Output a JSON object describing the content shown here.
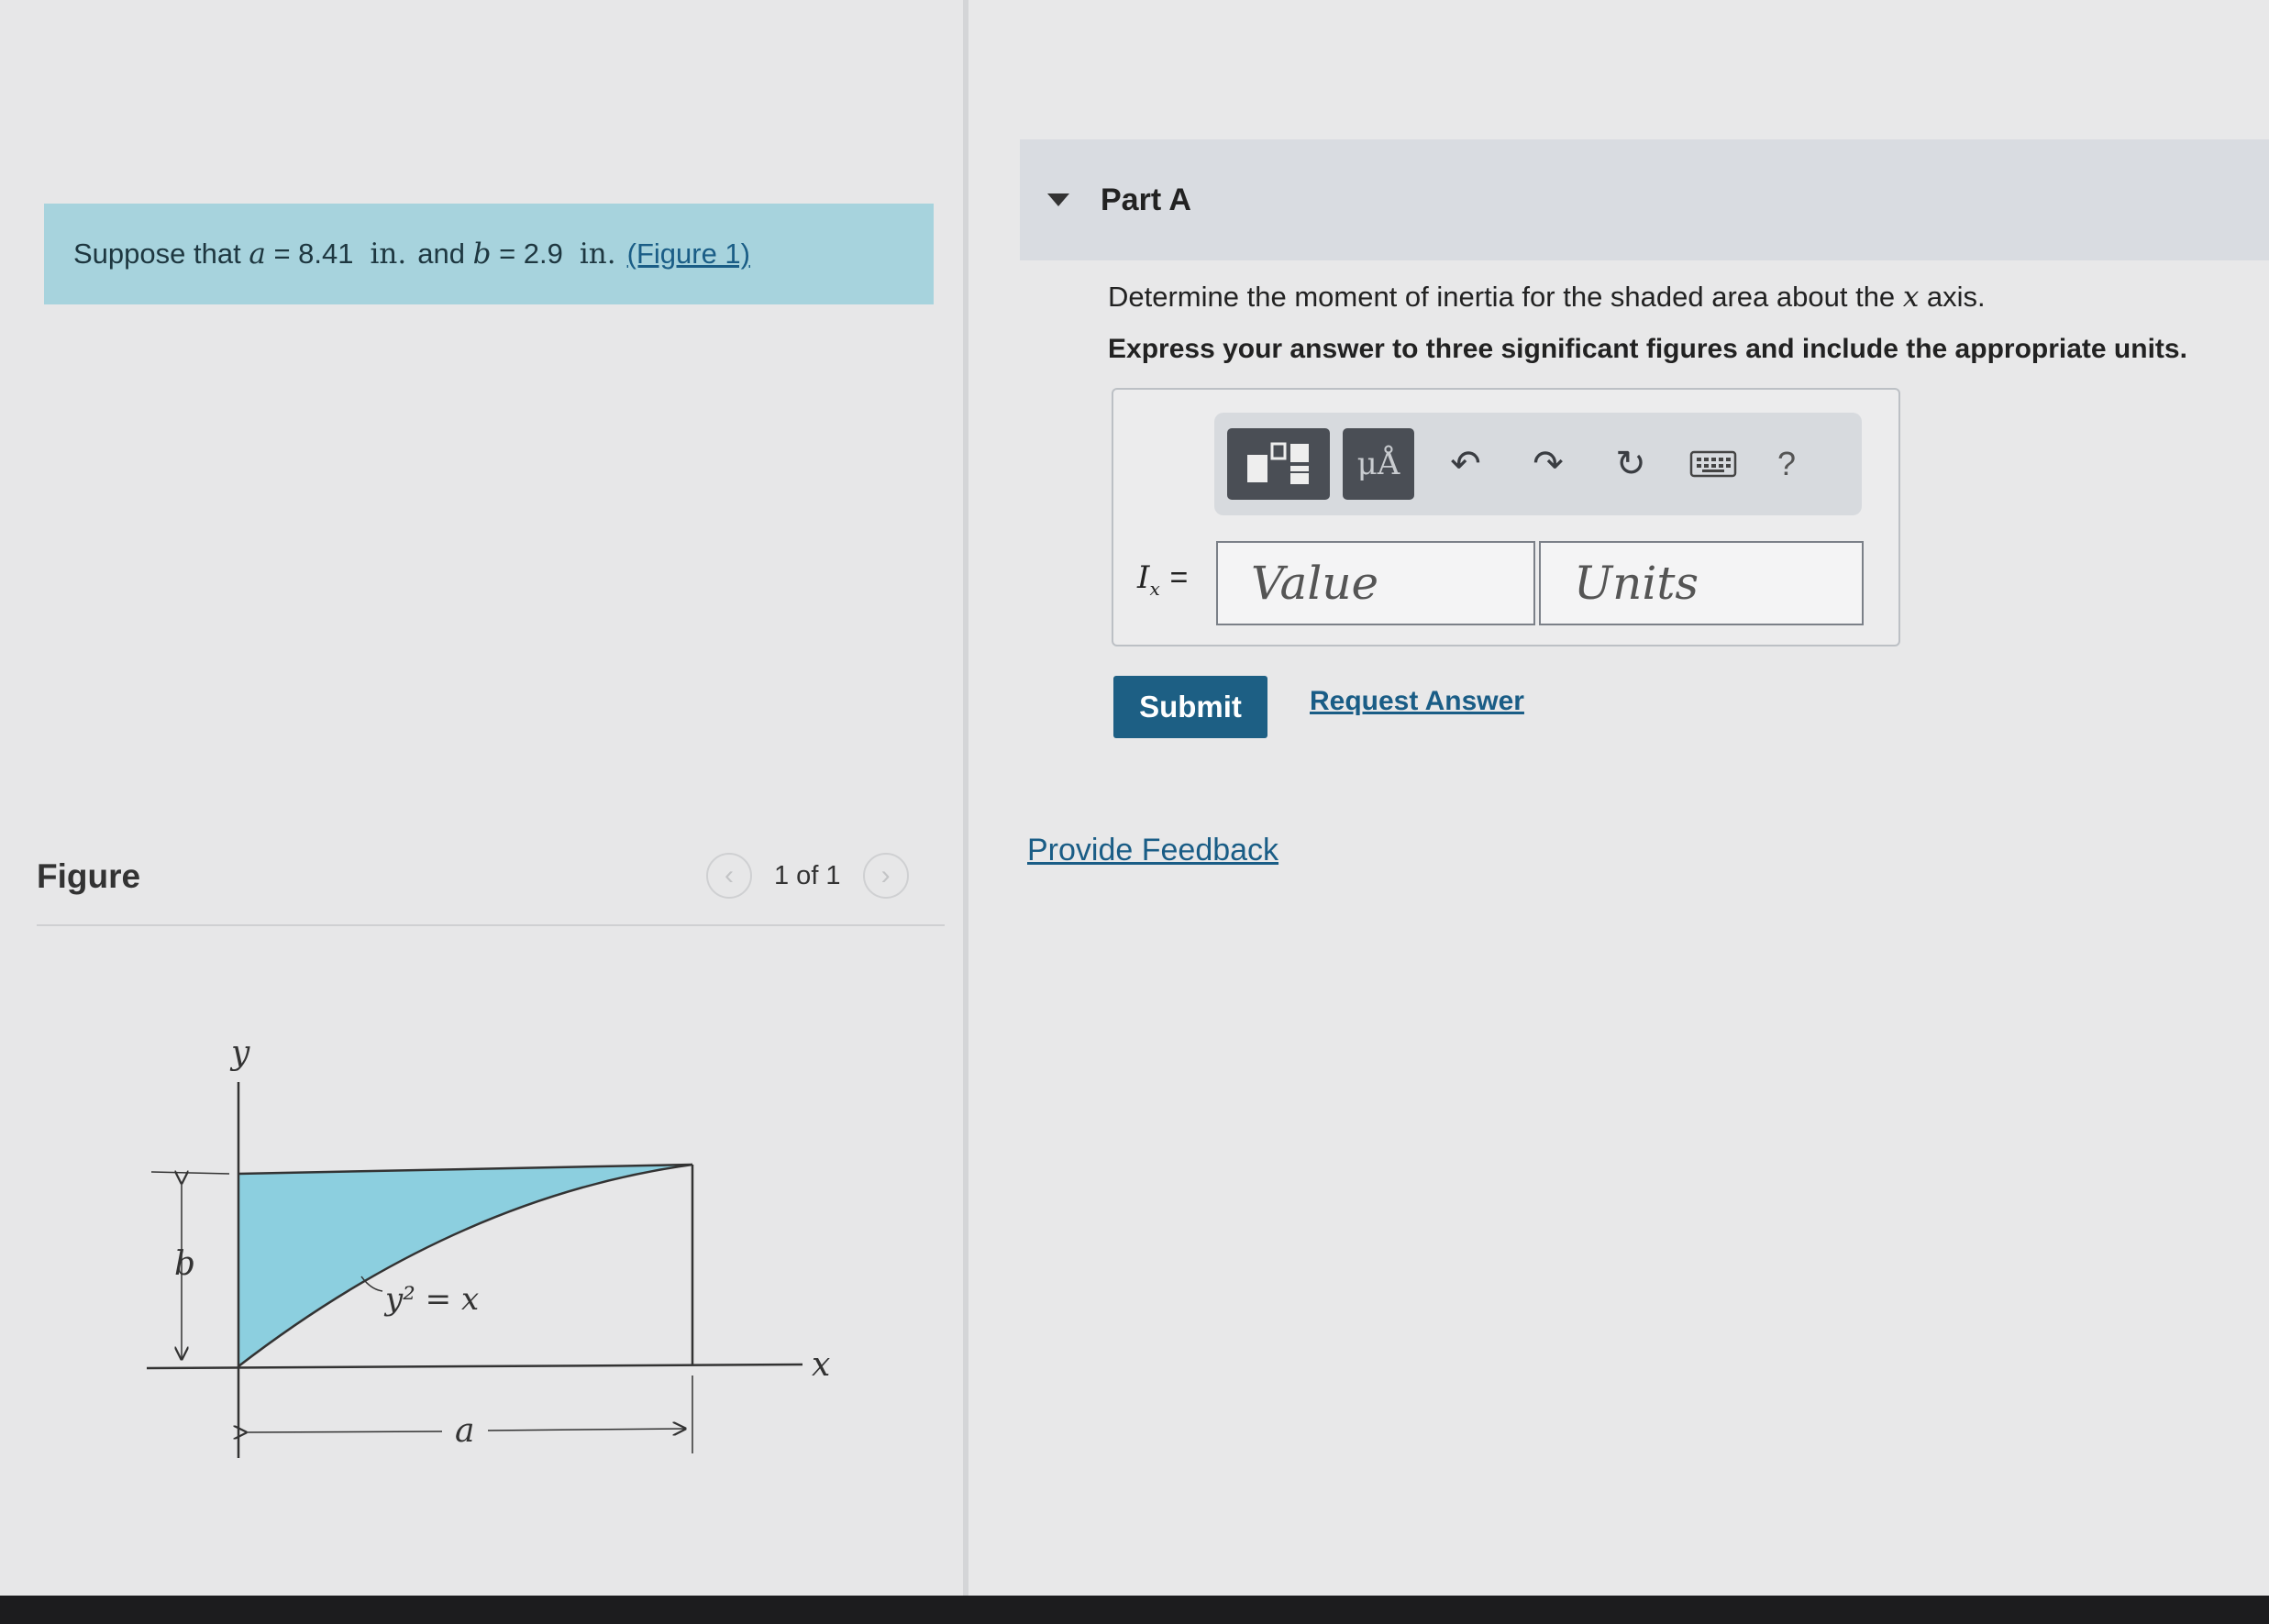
{
  "problem": {
    "prefix": "Suppose that",
    "a_var": "a",
    "a_value": "= 8.41",
    "a_unit": "in.",
    "and_text": "and",
    "b_var": "b",
    "b_value": "= 2.9",
    "b_unit": "in.",
    "figure_link": "(Figure 1)"
  },
  "figure_panel": {
    "title": "Figure",
    "pager_text": "1 of 1",
    "prev_icon": "chevron-left-icon",
    "next_icon": "chevron-right-icon"
  },
  "figure": {
    "y_axis_label": "y",
    "x_axis_label": "x",
    "curve_label": "y² = x",
    "height_label": "b",
    "width_label": "a",
    "fill_color": "#8ccfdf"
  },
  "part": {
    "title": "Part A",
    "question_pre": "Determine the moment of inertia for the shaded area about the",
    "question_var": "x",
    "question_post": "axis.",
    "instructions": "Express your answer to three significant figures and include the appropriate units."
  },
  "toolbar": {
    "templates_icon": "templates-icon",
    "units_label": "μÅ",
    "undo_icon": "undo-icon",
    "redo_icon": "redo-icon",
    "reset_icon": "reset-icon",
    "keyboard_icon": "keyboard-icon",
    "help_label": "?"
  },
  "answer": {
    "symbol": "I",
    "subscript": "x",
    "equals": "=",
    "value_placeholder": "Value",
    "units_placeholder": "Units"
  },
  "actions": {
    "submit_label": "Submit",
    "request_answer_label": "Request Answer",
    "feedback_label": "Provide Feedback"
  },
  "colors": {
    "problem_bg": "#a7d3dd",
    "submit_bg": "#1d5f84",
    "link": "#1a5d86"
  }
}
